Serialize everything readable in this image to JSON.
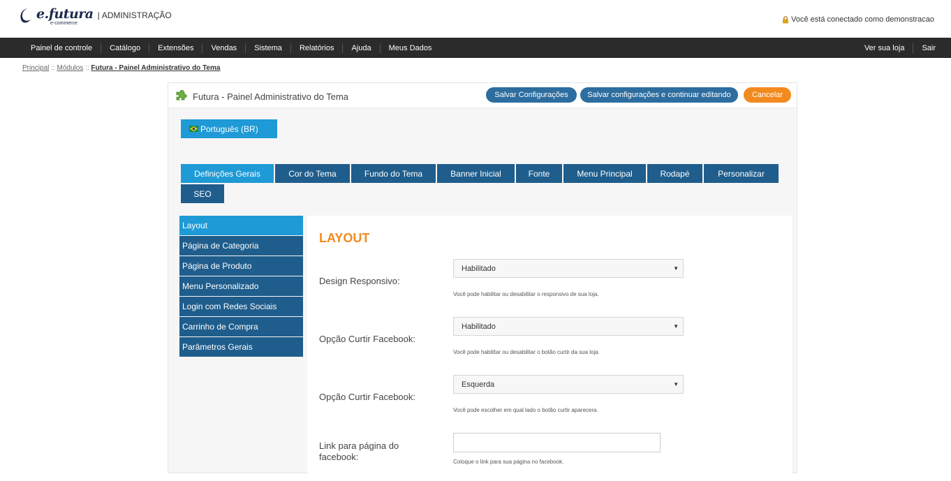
{
  "header": {
    "logo_brand": "e.futura",
    "logo_sub": "e-commerce",
    "logo_section": "ADMINISTRAÇÃO",
    "user_status": "Você está conectado como demonstracao"
  },
  "topmenu": {
    "left": [
      "Painel de controle",
      "Catálogo",
      "Extensões",
      "Vendas",
      "Sistema",
      "Relatórios",
      "Ajuda",
      "Meus Dados"
    ],
    "right": [
      "Ver sua loja",
      "Sair"
    ]
  },
  "breadcrumb": {
    "items": [
      "Principal",
      "Módulos",
      "Futura - Painel Administrativo do Tema"
    ],
    "separator": "::"
  },
  "panel": {
    "title": "Futura - Painel Administrativo do Tema",
    "save_label": "Salvar Configurações",
    "save_continue_label": "Salvar configurações e continuar editando",
    "cancel_label": "Cancelar",
    "language": "Português (BR)"
  },
  "tabs": [
    "Definições Gerais",
    "Cor do Tema",
    "Fundo do Tema",
    "Banner Inicial",
    "Fonte",
    "Menu Principal",
    "Rodapé",
    "Personalizar",
    "SEO"
  ],
  "sidenav": [
    "Layout",
    "Página de Categoria",
    "Página de Produto",
    "Menu Personalizado",
    "Login com Redes Sociais",
    "Carrinho de Compra",
    "Parâmetros Gerais"
  ],
  "content": {
    "title": "LAYOUT",
    "fields": [
      {
        "label": "Design Responsivo:",
        "value": "Habilitado",
        "hint": "Você pode habilitar ou desabilitar o responsivo de sua loja."
      },
      {
        "label": "Opção Curtir Facebook:",
        "value": "Habilitado",
        "hint": "Você pode habilitar ou desabilitar o botão curtir da sua loja."
      },
      {
        "label": "Opção Curtir Facebook:",
        "value": "Esquerda",
        "hint": "Você pode escolher em qual lado o botão curtir aparecera."
      },
      {
        "label": "Link para página do facebook:",
        "value": "",
        "hint": "Coloque o link para sua página no facebook."
      }
    ]
  },
  "colors": {
    "primary": "#1f5d8c",
    "active": "#1e9ad6",
    "accent": "#f28a1f",
    "topbar": "#2b2b2b"
  }
}
